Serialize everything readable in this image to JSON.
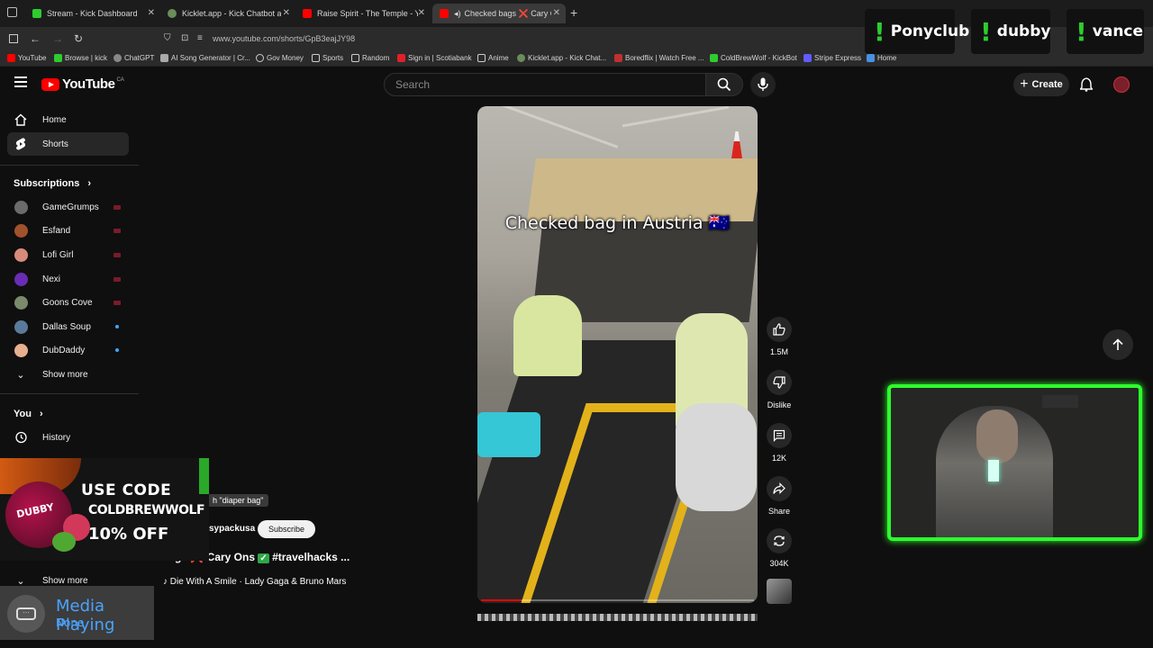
{
  "browser": {
    "tabs": [
      {
        "title": "Stream - Kick Dashboard",
        "active": false,
        "color": "#2ecc2e"
      },
      {
        "title": "Kicklet.app - Kick Chatbot and",
        "active": false,
        "color": "#6a8d5a"
      },
      {
        "title": "Raise Spirit - The Temple - YouT",
        "active": false,
        "color": "#ff0000"
      },
      {
        "title": "Checked bags ❌ Cary Ons",
        "active": true,
        "color": "#ff0000"
      }
    ],
    "new_tab": "+",
    "url": "www.youtube.com/shorts/GpB3eajJY98",
    "bookmarks": [
      {
        "label": "YouTube",
        "color": "#ff0000"
      },
      {
        "label": "Browse | kick",
        "color": "#2ecc2e"
      },
      {
        "label": "ChatGPT",
        "color": "#888888"
      },
      {
        "label": "AI Song Generator | Cr...",
        "color": "#aaaaaa"
      },
      {
        "label": "Gov Money",
        "color": "#aaaaaa"
      },
      {
        "label": "Sports",
        "color": "#aaaaaa"
      },
      {
        "label": "Random",
        "color": "#aaaaaa"
      },
      {
        "label": "Sign in | Scotiabank",
        "color": "#e0202a"
      },
      {
        "label": "Anime",
        "color": "#aaaaaa"
      },
      {
        "label": "Kicklet.app - Kick Chat...",
        "color": "#6a8d5a"
      },
      {
        "label": "Boredflix | Watch Free ...",
        "color": "#c03030"
      },
      {
        "label": "ColdBrewWolf - KickBot",
        "color": "#2ecc2e"
      },
      {
        "label": "Stripe Express",
        "color": "#635bff"
      },
      {
        "label": "Home",
        "color": "#4a90e2"
      }
    ]
  },
  "stream_badges": [
    {
      "mark": "!",
      "name": "Ponyclub"
    },
    {
      "mark": "!",
      "name": "dubby"
    },
    {
      "mark": "!",
      "name": "vance"
    }
  ],
  "header": {
    "logo": "YouTube",
    "country": "CA",
    "search_placeholder": "Search",
    "create_label": "Create"
  },
  "sidebar": {
    "home": "Home",
    "shorts": "Shorts",
    "subscriptions_title": "Subscriptions",
    "subscriptions": [
      {
        "name": "GameGrumps",
        "indicator": "live",
        "avatar": "#6b6b6b"
      },
      {
        "name": "Esfand",
        "indicator": "live",
        "avatar": "#a0522d"
      },
      {
        "name": "Lofi Girl",
        "indicator": "live",
        "avatar": "#d88b7b"
      },
      {
        "name": "Nexi",
        "indicator": "live",
        "avatar": "#6a2cb5"
      },
      {
        "name": "Goons Cove",
        "indicator": "live",
        "avatar": "#7a8a6a"
      },
      {
        "name": "Dallas Soup",
        "indicator": "new",
        "avatar": "#5a7a9a"
      },
      {
        "name": "DubDaddy",
        "indicator": "new",
        "avatar": "#e8b090"
      }
    ],
    "show_more": "Show more",
    "you_title": "You",
    "history": "History",
    "show_more_2": "Show more"
  },
  "promo": {
    "line1": "USE CODE",
    "line2": "COLDBREWWOLF",
    "line3": "10% OFF",
    "brand": "DUBBY"
  },
  "media": {
    "title": "Media Playing",
    "subtitle": "None"
  },
  "short": {
    "hint": "h \"diaper bag\"",
    "channel": "sypackusa",
    "subscribe": "Subscribe",
    "title_prefix": "bags",
    "title_x": "❌",
    "title_mid": "Cary Ons",
    "title_check": "✓",
    "title_tags": "#travelhacks ...",
    "song": "♪ Die With A Smile · Lady Gaga & Bruno Mars",
    "video_caption": "Checked bag in Austria 🇦🇺",
    "progress": 0.15
  },
  "actions": {
    "like_count": "1.5M",
    "dislike": "Dislike",
    "comment_count": "12K",
    "share": "Share",
    "remix_count": "304K"
  }
}
